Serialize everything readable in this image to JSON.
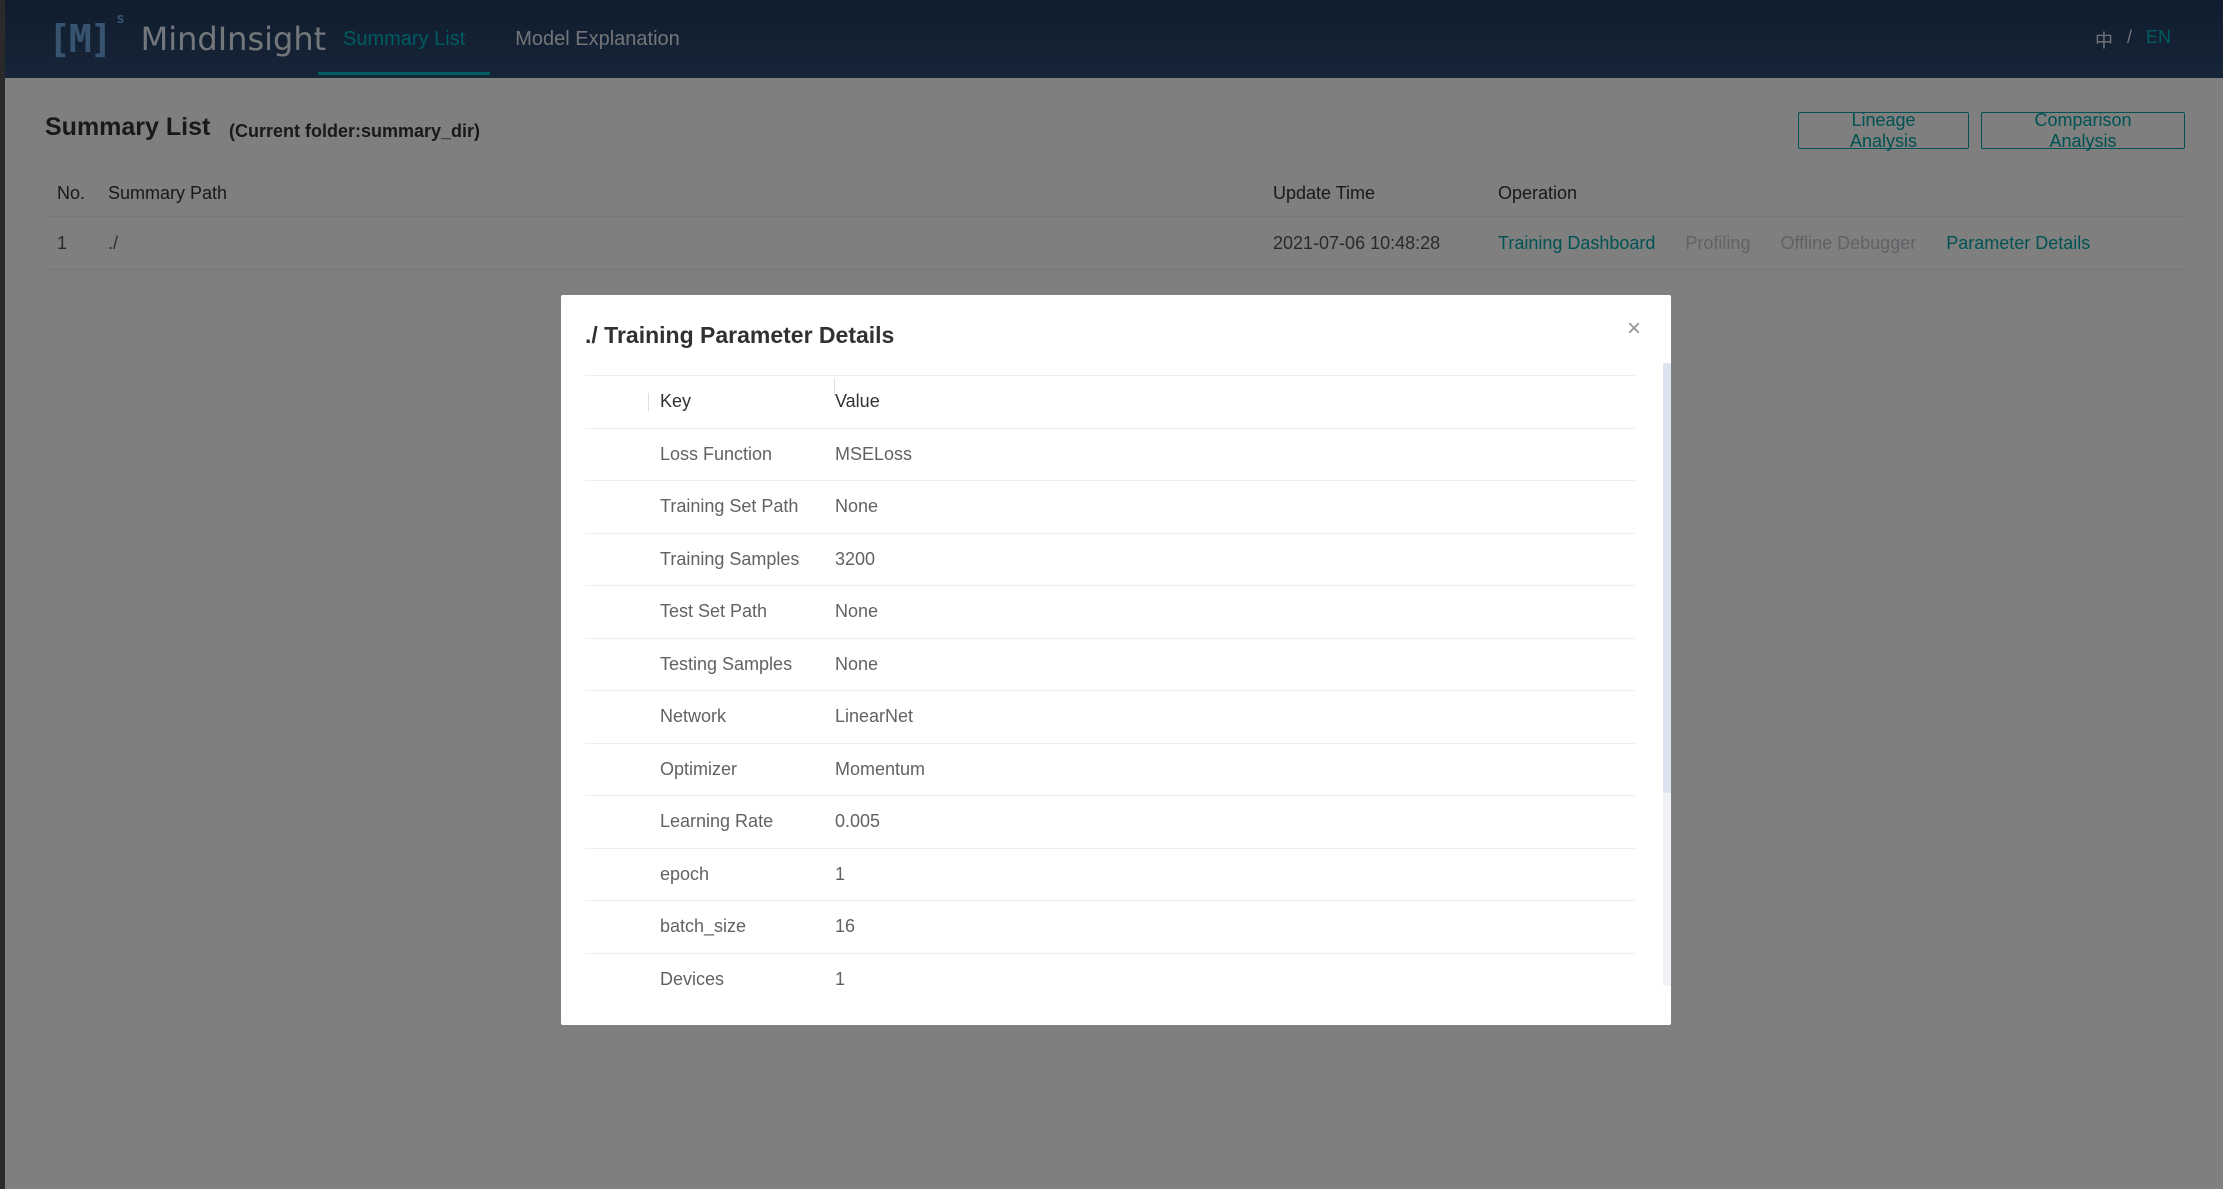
{
  "header": {
    "logo_mark": "[M]",
    "logo_sup": "s",
    "logo_text": "MindInsight",
    "tabs": [
      {
        "label": "Summary List",
        "active": true
      },
      {
        "label": "Model Explanation",
        "active": false
      }
    ],
    "lang": {
      "zh": "中",
      "sep": "/",
      "en": "EN"
    }
  },
  "page": {
    "title": "Summary List",
    "folder_note": "(Current folder:summary_dir)",
    "lineage_button": "Lineage Analysis",
    "comparison_button": "Comparison Analysis"
  },
  "list": {
    "columns": [
      "No.",
      "Summary Path",
      "Update Time",
      "Operation"
    ],
    "rows": [
      {
        "no": "1",
        "path": "./",
        "time": "2021-07-06 10:48:28",
        "ops": {
          "dashboard": "Training Dashboard",
          "profiling": "Profiling",
          "debugger": "Offline Debugger",
          "params": "Parameter Details"
        }
      }
    ]
  },
  "dialog": {
    "title": "./ Training Parameter Details",
    "close": "×",
    "columns": {
      "key": "Key",
      "value": "Value"
    },
    "rows": [
      {
        "key": "Loss Function",
        "value": "MSELoss"
      },
      {
        "key": "Training Set Path",
        "value": "None"
      },
      {
        "key": "Training Samples",
        "value": "3200"
      },
      {
        "key": "Test Set Path",
        "value": "None"
      },
      {
        "key": "Testing Samples",
        "value": "None"
      },
      {
        "key": "Network",
        "value": "LinearNet"
      },
      {
        "key": "Optimizer",
        "value": "Momentum"
      },
      {
        "key": "Learning Rate",
        "value": "0.005"
      },
      {
        "key": "epoch",
        "value": "1"
      },
      {
        "key": "batch_size",
        "value": "16"
      },
      {
        "key": "Devices",
        "value": "1"
      }
    ]
  },
  "colors": {
    "accent": "#00a5a7",
    "header_bg": "#1f3a5e",
    "disabled": "#c0c4cc"
  }
}
